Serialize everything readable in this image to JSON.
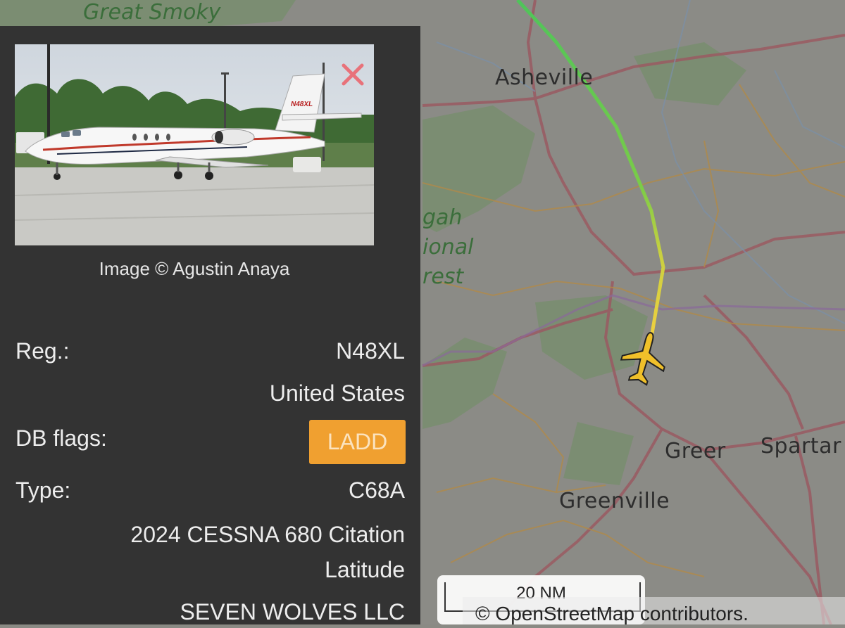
{
  "map": {
    "places": {
      "asheville": "Asheville",
      "greer": "Greer",
      "spartanburg": "Spartar",
      "greenville": "Greenville",
      "smoky": "Great Smoky"
    },
    "park_fragment": [
      "gah",
      "ional",
      "rest"
    ],
    "scale_label": "20 NM",
    "attribution": "© OpenStreetMap contributors.",
    "track_colors": {
      "start": "#5cc85c",
      "end": "#f0d040"
    },
    "aircraft_icon": "plane-icon",
    "aircraft_color": "#f0c02a"
  },
  "panel": {
    "photo_credit": "Image © Agustin Anaya",
    "photo_tail_text": "N48XL",
    "reg_label": "Reg.:",
    "reg_value": "N48XL",
    "country": "United States",
    "db_flags_label": "DB flags:",
    "db_flag": "LADD",
    "type_label": "Type:",
    "type_value": "C68A",
    "desc_line1": "2024 CESSNA 680 Citation",
    "desc_line2": "Latitude",
    "owner": "SEVEN WOLVES LLC"
  },
  "colors": {
    "panel_bg": "#333333",
    "flag_badge": "#f0a030",
    "close_x": "#e8727a"
  }
}
